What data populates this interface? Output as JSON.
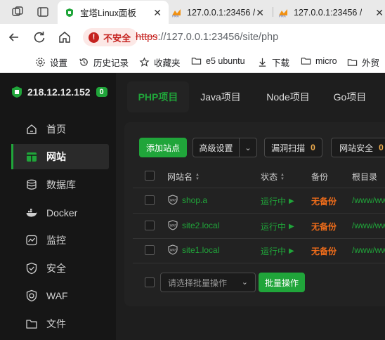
{
  "browser": {
    "tabs": [
      {
        "title": "宝塔Linux面板",
        "active": true
      },
      {
        "title": "127.0.0.1:23456 /",
        "active": false
      },
      {
        "title": "127.0.0.1:23456 /",
        "active": false
      }
    ],
    "security_label": "不安全",
    "url_protocol": "https",
    "url_rest": "://127.0.0.1:23456/site/php",
    "bookmarks": [
      {
        "label": "设置",
        "icon": "gear-icon"
      },
      {
        "label": "历史记录",
        "icon": "history-icon"
      },
      {
        "label": "收藏夹",
        "icon": "favorites-icon"
      },
      {
        "label": "e5 ubuntu",
        "icon": "folder-icon"
      },
      {
        "label": "下载",
        "icon": "download-icon"
      },
      {
        "label": "micro",
        "icon": "folder-icon"
      },
      {
        "label": "外贸",
        "icon": "folder-icon"
      }
    ]
  },
  "sidebar": {
    "server_ip": "218.12.12.152",
    "server_badge": "0",
    "items": [
      {
        "label": "首页",
        "icon": "home-icon",
        "active": false
      },
      {
        "label": "网站",
        "icon": "globe-icon",
        "active": true
      },
      {
        "label": "数据库",
        "icon": "database-icon",
        "active": false
      },
      {
        "label": "Docker",
        "icon": "docker-icon",
        "active": false
      },
      {
        "label": "监控",
        "icon": "monitor-icon",
        "active": false
      },
      {
        "label": "安全",
        "icon": "shield-icon",
        "active": false
      },
      {
        "label": "WAF",
        "icon": "waf-icon",
        "active": false
      },
      {
        "label": "文件",
        "icon": "folder-icon",
        "active": false
      }
    ]
  },
  "project_tabs": [
    "PHP项目",
    "Java项目",
    "Node项目",
    "Go项目"
  ],
  "toolbar": {
    "add_site": "添加站点",
    "advanced": "高级设置",
    "vuln_scan": "漏洞扫描",
    "vuln_count": "0",
    "site_security": "网站安全",
    "security_count": "0"
  },
  "table": {
    "headers": {
      "name": "网站名",
      "status": "状态",
      "backup": "备份",
      "root": "根目录"
    },
    "rows": [
      {
        "name": "shop.a",
        "status": "运行中",
        "backup": "无备份",
        "root": "/www/ww"
      },
      {
        "name": "site2.local",
        "status": "运行中",
        "backup": "无备份",
        "root": "/www/ww"
      },
      {
        "name": "site1.local",
        "status": "运行中",
        "backup": "无备份",
        "root": "/www/ww"
      }
    ]
  },
  "batch": {
    "placeholder": "请选择批量操作",
    "button": "批量操作"
  },
  "colors": {
    "accent": "#20a53a",
    "warning": "#ef6c1a",
    "danger": "#c5221f",
    "background": "#1c1c1c"
  }
}
